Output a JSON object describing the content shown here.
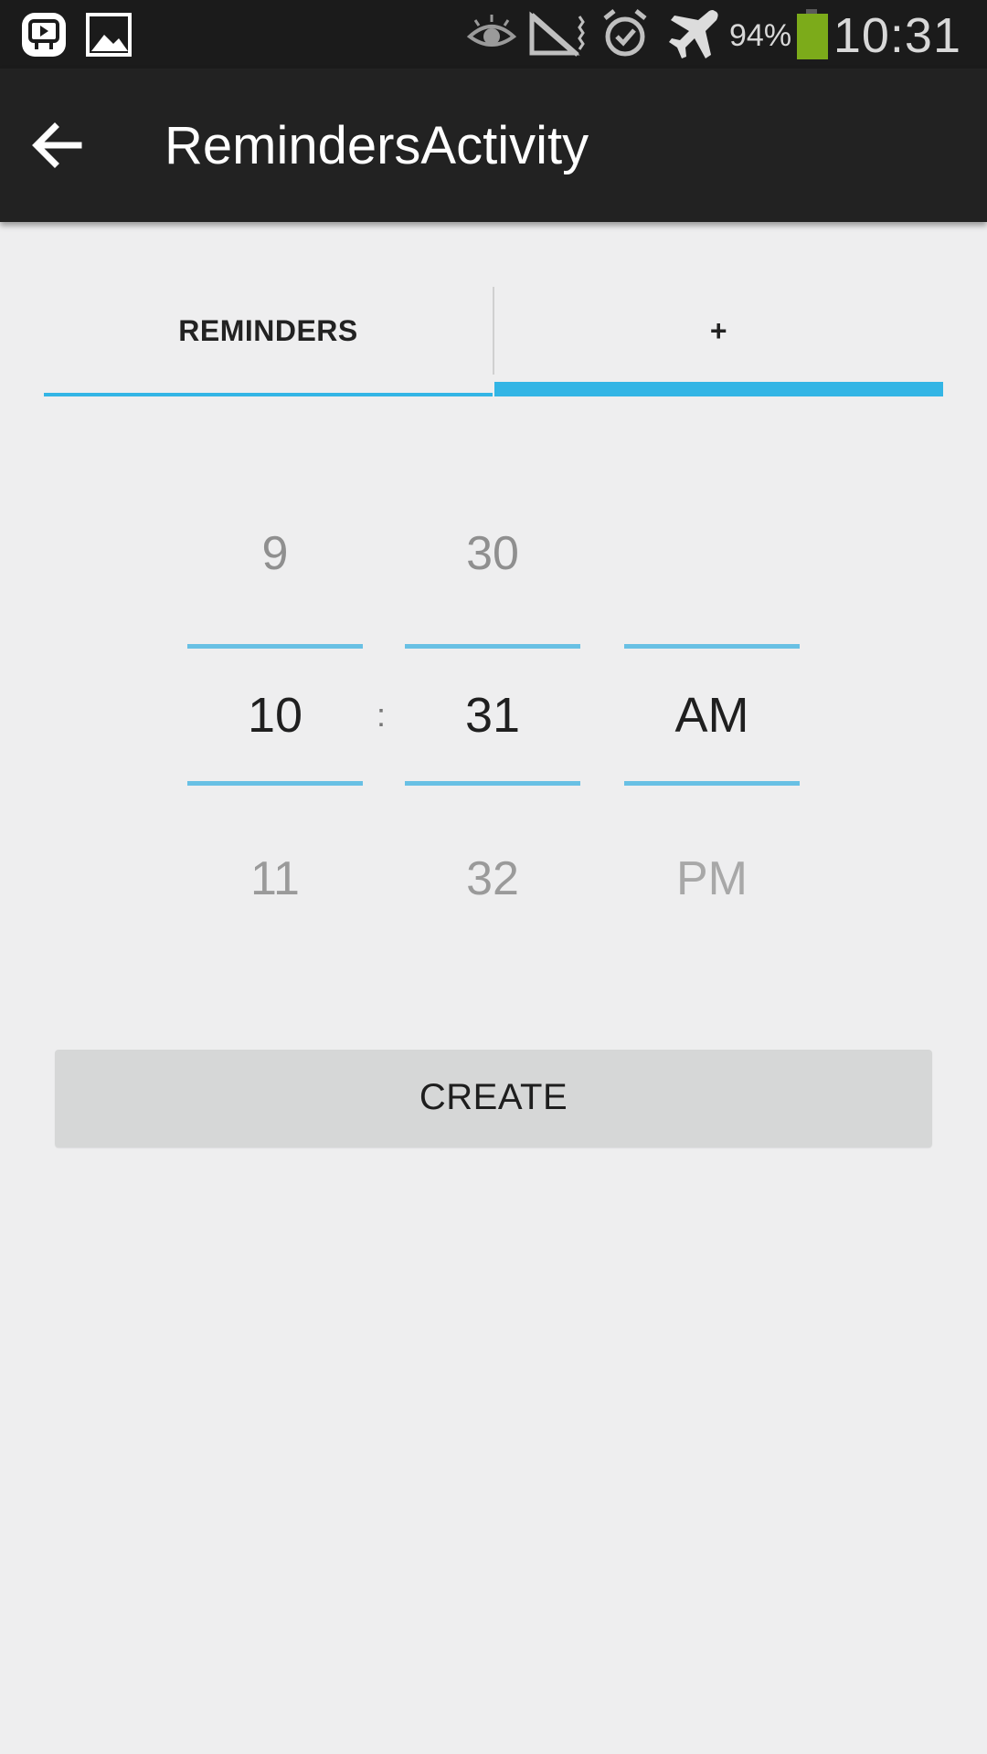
{
  "status_bar": {
    "time": "10:31",
    "battery_percent": "94%",
    "battery_level": 0.94,
    "icons": [
      "video-app-icon",
      "gallery-icon",
      "eye-icon",
      "no-signal-icon",
      "alarm-icon",
      "airplane-icon",
      "battery-icon"
    ],
    "battery_color": "#7cab1a"
  },
  "action_bar": {
    "title": "RemindersActivity",
    "back_icon": "back-arrow-icon"
  },
  "tabs": [
    {
      "label": "REMINDERS",
      "selected": false
    },
    {
      "label": "+",
      "selected": true
    }
  ],
  "accent_color": "#33b5e5",
  "time_picker": {
    "hour": {
      "prev": "9",
      "current": "10",
      "next": "11"
    },
    "separator": ":",
    "minute": {
      "prev": "30",
      "current": "31",
      "next": "32"
    },
    "ampm": {
      "prev": "",
      "current": "AM",
      "next": "PM"
    }
  },
  "create_button": {
    "label": "CREATE"
  }
}
